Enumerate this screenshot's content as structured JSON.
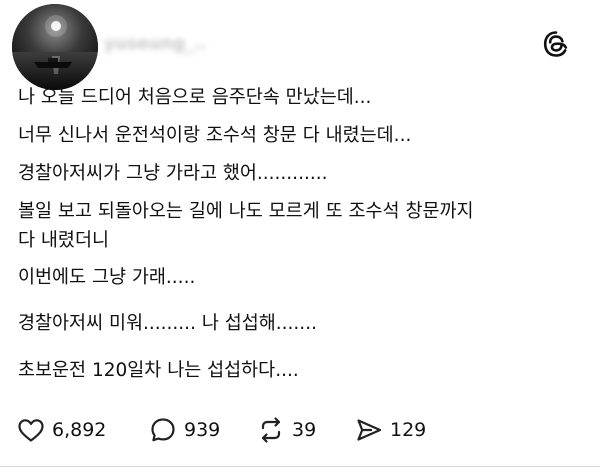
{
  "post": {
    "username": "yuseung_..",
    "lines": [
      "나 오늘 드디어 처음으로 음주단속 만났는데...",
      "너무 신나서 운전석이랑 조수석 창문 다 내렸는데...",
      "경찰아저씨가 그냥 가라고 했어............",
      "볼일 보고 되돌아오는 길에 나도 모르게 또 조수석 창문까지",
      "다 내렸더니",
      "이번에도 그냥 가래.....",
      "경찰아저씨 미워......... 나 섭섭해.......",
      "초보운전 120일차 나는 섭섭하다...."
    ]
  },
  "actions": {
    "likes": "6,892",
    "comments": "939",
    "reposts": "39",
    "shares": "129"
  },
  "icons": {
    "like": "heart-icon",
    "comment": "comment-bubble-icon",
    "repost": "repost-icon",
    "share": "send-icon",
    "brand": "threads-logo-icon"
  }
}
